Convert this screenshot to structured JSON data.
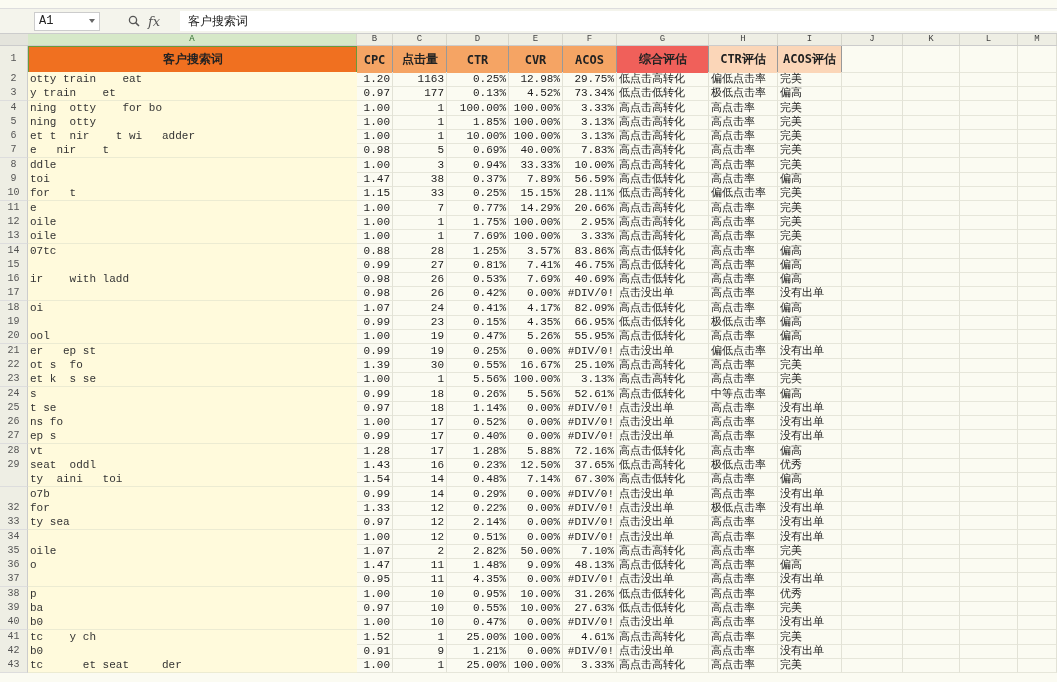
{
  "formula_bar": {
    "cell_ref": "A1",
    "fx": "fx",
    "value": "客户搜索词"
  },
  "column_letters": [
    "A",
    "B",
    "C",
    "D",
    "E",
    "F",
    "G",
    "H",
    "I",
    "J",
    "K",
    "L",
    "M"
  ],
  "header_row": "1",
  "header": [
    {
      "label": "客户搜索词",
      "color": "#f07020"
    },
    {
      "label": "CPC",
      "color": "#f5a464"
    },
    {
      "label": "点击量",
      "color": "#f5a464"
    },
    {
      "label": "CTR",
      "color": "#f5a464"
    },
    {
      "label": "CVR",
      "color": "#f5a464"
    },
    {
      "label": "ACOS",
      "color": "#f5a464"
    },
    {
      "label": "综合评估",
      "color": "#f0605a"
    },
    {
      "label": "CTR评估",
      "color": "#fbd6b8"
    },
    {
      "label": "ACOS评估",
      "color": "#fbd6b8"
    }
  ],
  "rows": [
    {
      "row": "2",
      "column_a": "otty train    eat",
      "cells": [
        "1.20",
        "1163",
        "0.25%",
        "12.98%",
        "29.75%",
        "低点击高转化",
        "偏低点击率",
        "完美"
      ]
    },
    {
      "row": "3",
      "column_a": "y train    et",
      "cells": [
        "0.97",
        "177",
        "0.13%",
        "4.52%",
        "73.34%",
        "低点击低转化",
        "极低点击率",
        "偏高"
      ]
    },
    {
      "row": "4",
      "column_a": "ning  otty    for bo",
      "cells": [
        "1.00",
        "1",
        "100.00%",
        "100.00%",
        "3.33%",
        "高点击高转化",
        "高点击率",
        "完美"
      ]
    },
    {
      "row": "5",
      "column_a": "ning  otty",
      "cells": [
        "1.00",
        "1",
        "1.85%",
        "100.00%",
        "3.13%",
        "高点击高转化",
        "高点击率",
        "完美"
      ]
    },
    {
      "row": "6",
      "column_a": "et t  nir    t wi   adder",
      "cells": [
        "1.00",
        "1",
        "10.00%",
        "100.00%",
        "3.13%",
        "高点击高转化",
        "高点击率",
        "完美"
      ]
    },
    {
      "row": "7",
      "column_a": "e   nir    t",
      "cells": [
        "0.98",
        "5",
        "0.69%",
        "40.00%",
        "7.83%",
        "高点击高转化",
        "高点击率",
        "完美"
      ]
    },
    {
      "row": "8",
      "column_a": "ddle",
      "cells": [
        "1.00",
        "3",
        "0.94%",
        "33.33%",
        "10.00%",
        "高点击高转化",
        "高点击率",
        "完美"
      ]
    },
    {
      "row": "9",
      "column_a": "toi",
      "cells": [
        "1.47",
        "38",
        "0.37%",
        "7.89%",
        "56.59%",
        "高点击低转化",
        "高点击率",
        "偏高"
      ]
    },
    {
      "row": "10",
      "column_a": "for   t",
      "cells": [
        "1.15",
        "33",
        "0.25%",
        "15.15%",
        "28.11%",
        "低点击高转化",
        "偏低点击率",
        "完美"
      ]
    },
    {
      "row": "11",
      "column_a": "e",
      "cells": [
        "1.00",
        "7",
        "0.77%",
        "14.29%",
        "20.66%",
        "高点击高转化",
        "高点击率",
        "完美"
      ]
    },
    {
      "row": "12",
      "column_a": "oile",
      "cells": [
        "1.00",
        "1",
        "1.75%",
        "100.00%",
        "2.95%",
        "高点击高转化",
        "高点击率",
        "完美"
      ]
    },
    {
      "row": "13",
      "column_a": "oile",
      "cells": [
        "1.00",
        "1",
        "7.69%",
        "100.00%",
        "3.33%",
        "高点击高转化",
        "高点击率",
        "完美"
      ]
    },
    {
      "row": "14",
      "column_a": "07tc",
      "cells": [
        "0.88",
        "28",
        "1.25%",
        "3.57%",
        "83.86%",
        "高点击低转化",
        "高点击率",
        "偏高"
      ]
    },
    {
      "row": "15",
      "cells": [
        "0.99",
        "27",
        "0.81%",
        "7.41%",
        "46.75%",
        "高点击低转化",
        "高点击率",
        "偏高"
      ]
    },
    {
      "row": "16",
      "column_a": "ir    with ladd",
      "cells": [
        "0.98",
        "26",
        "0.53%",
        "7.69%",
        "40.69%",
        "高点击低转化",
        "高点击率",
        "偏高"
      ]
    },
    {
      "row": "17",
      "cells": [
        "0.98",
        "26",
        "0.42%",
        "0.00%",
        "#DIV/0!",
        "点击没出单",
        "高点击率",
        "没有出单"
      ]
    },
    {
      "row": "18",
      "column_a": "oi",
      "cells": [
        "1.07",
        "24",
        "0.41%",
        "4.17%",
        "82.09%",
        "高点击低转化",
        "高点击率",
        "偏高"
      ]
    },
    {
      "row": "19",
      "cells": [
        "0.99",
        "23",
        "0.15%",
        "4.35%",
        "66.95%",
        "低点击低转化",
        "极低点击率",
        "偏高"
      ]
    },
    {
      "row": "20",
      "column_a": "ool",
      "cells": [
        "1.00",
        "19",
        "0.47%",
        "5.26%",
        "55.95%",
        "高点击低转化",
        "高点击率",
        "偏高"
      ]
    },
    {
      "row": "21",
      "column_a": "er   ep st",
      "cells": [
        "0.99",
        "19",
        "0.25%",
        "0.00%",
        "#DIV/0!",
        "点击没出单",
        "偏低点击率",
        "没有出单"
      ]
    },
    {
      "row": "22",
      "column_a": "ot s  fo",
      "cells": [
        "1.39",
        "30",
        "0.55%",
        "16.67%",
        "25.10%",
        "高点击高转化",
        "高点击率",
        "完美"
      ]
    },
    {
      "row": "23",
      "column_a": "et k  s se",
      "cells": [
        "1.00",
        "1",
        "5.56%",
        "100.00%",
        "3.13%",
        "高点击高转化",
        "高点击率",
        "完美"
      ]
    },
    {
      "row": "24",
      "column_a": "s",
      "cells": [
        "0.99",
        "18",
        "0.26%",
        "5.56%",
        "52.61%",
        "高点击低转化",
        "中等点击率",
        "偏高"
      ]
    },
    {
      "row": "25",
      "column_a": "t se",
      "cells": [
        "0.97",
        "18",
        "1.14%",
        "0.00%",
        "#DIV/0!",
        "点击没出单",
        "高点击率",
        "没有出单"
      ]
    },
    {
      "row": "26",
      "column_a": "ns fo",
      "cells": [
        "1.00",
        "17",
        "0.52%",
        "0.00%",
        "#DIV/0!",
        "点击没出单",
        "高点击率",
        "没有出单"
      ]
    },
    {
      "row": "27",
      "column_a": "ep s",
      "cells": [
        "0.99",
        "17",
        "0.40%",
        "0.00%",
        "#DIV/0!",
        "点击没出单",
        "高点击率",
        "没有出单"
      ]
    },
    {
      "row": "28",
      "column_a": "vt",
      "cells": [
        "1.28",
        "17",
        "1.28%",
        "5.88%",
        "72.16%",
        "高点击低转化",
        "高点击率",
        "偏高"
      ]
    },
    {
      "row": "29",
      "column_a": "seat  oddl",
      "cells": [
        "1.43",
        "16",
        "0.23%",
        "12.50%",
        "37.65%",
        "低点击高转化",
        "极低点击率",
        "优秀"
      ]
    },
    {
      "column_a": "ty  aini   toi",
      "cells": [
        "1.54",
        "14",
        "0.48%",
        "7.14%",
        "67.30%",
        "高点击低转化",
        "高点击率",
        "偏高"
      ]
    },
    {
      "column_a": "o7b",
      "cells": [
        "0.99",
        "14",
        "0.29%",
        "0.00%",
        "#DIV/0!",
        "点击没出单",
        "高点击率",
        "没有出单"
      ]
    },
    {
      "row": "32",
      "column_a": "for",
      "cells": [
        "1.33",
        "12",
        "0.22%",
        "0.00%",
        "#DIV/0!",
        "点击没出单",
        "极低点击率",
        "没有出单"
      ]
    },
    {
      "row": "33",
      "column_a": "ty sea",
      "cells": [
        "0.97",
        "12",
        "2.14%",
        "0.00%",
        "#DIV/0!",
        "点击没出单",
        "高点击率",
        "没有出单"
      ]
    },
    {
      "row": "34",
      "cells": [
        "1.00",
        "12",
        "0.51%",
        "0.00%",
        "#DIV/0!",
        "点击没出单",
        "高点击率",
        "没有出单"
      ]
    },
    {
      "row": "35",
      "column_a": "oile",
      "cells": [
        "1.07",
        "2",
        "2.82%",
        "50.00%",
        "7.10%",
        "高点击高转化",
        "高点击率",
        "完美"
      ]
    },
    {
      "row": "36",
      "column_a": "o",
      "cells": [
        "1.47",
        "11",
        "1.48%",
        "9.09%",
        "48.13%",
        "高点击低转化",
        "高点击率",
        "偏高"
      ]
    },
    {
      "row": "37",
      "cells": [
        "0.95",
        "11",
        "4.35%",
        "0.00%",
        "#DIV/0!",
        "点击没出单",
        "高点击率",
        "没有出单"
      ]
    },
    {
      "row": "38",
      "column_a": "p",
      "cells": [
        "1.00",
        "10",
        "0.95%",
        "10.00%",
        "31.26%",
        "低点击低转化",
        "高点击率",
        "优秀"
      ]
    },
    {
      "row": "39",
      "column_a": "ba",
      "cells": [
        "0.97",
        "10",
        "0.55%",
        "10.00%",
        "27.63%",
        "低点击低转化",
        "高点击率",
        "完美"
      ]
    },
    {
      "row": "40",
      "column_a": "b0",
      "cells": [
        "1.00",
        "10",
        "0.47%",
        "0.00%",
        "#DIV/0!",
        "点击没出单",
        "高点击率",
        "没有出单"
      ]
    },
    {
      "row": "41",
      "column_a": "tc    y ch",
      "cells": [
        "1.52",
        "1",
        "25.00%",
        "100.00%",
        "4.61%",
        "高点击高转化",
        "高点击率",
        "完美"
      ]
    },
    {
      "row": "42",
      "column_a": "b0",
      "cells": [
        "0.91",
        "9",
        "1.21%",
        "0.00%",
        "#DIV/0!",
        "点击没出单",
        "高点击率",
        "没有出单"
      ]
    },
    {
      "row": "43",
      "column_a": "tc      et seat     der",
      "cells": [
        "1.00",
        "1",
        "25.00%",
        "100.00%",
        "3.33%",
        "高点击高转化",
        "高点击率",
        "完美"
      ]
    }
  ]
}
